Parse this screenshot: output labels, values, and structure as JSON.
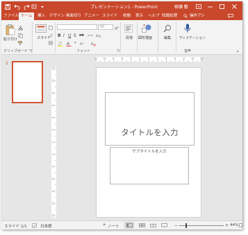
{
  "title_bar": {
    "window_title": "プレゼンテーション1  -  PowerPoint",
    "user_name": "柳瀬 敷",
    "icons": [
      "save-icon",
      "undo-icon",
      "redo-icon",
      "customize-icon",
      "ribbon-display-icon",
      "minimize-icon",
      "maximize-icon",
      "close-icon"
    ]
  },
  "tabs": [
    "ファイル",
    "ホーム",
    "挿入",
    "デザイン",
    "画面切り",
    "アニメー",
    "スライド",
    "校閲",
    "表示",
    "ヘルプ",
    "知識処理",
    "操作アシ"
  ],
  "active_tab": "ホーム",
  "ribbon": {
    "paste_label": "貼り付け",
    "slide_label": "スライド",
    "font_size_value": "60",
    "font_buttons": [
      "B",
      "I",
      "U",
      "S",
      "ab",
      "A"
    ],
    "paragraph_label": "段落",
    "drawing_label": "図形描画",
    "editing_label": "編集",
    "dictate_label": "ディクテーション",
    "groups": {
      "clipboard": "クリップボード",
      "font": "フォント",
      "voice": "音声"
    }
  },
  "thumbnail": {
    "slide_number": "1"
  },
  "slide": {
    "title_placeholder": "タイトルを入力",
    "subtitle_placeholder": "サブタイトルを入力"
  },
  "ruler": {
    "numbers": [
      "12",
      "10",
      "8",
      "6",
      "4",
      "2",
      "0",
      "2",
      "4",
      "6",
      "8",
      "10",
      "12"
    ]
  },
  "status_bar": {
    "slide_counter": "スライド 1/1",
    "language": "日本語",
    "notes_label": "ノート",
    "zoom_minus": "−",
    "zoom_plus": "+",
    "zoom_level": "44%"
  },
  "colors": {
    "accent": "#c9472b",
    "thumbnail_border": "#d35230",
    "dictate_icon": "#2b579a"
  }
}
